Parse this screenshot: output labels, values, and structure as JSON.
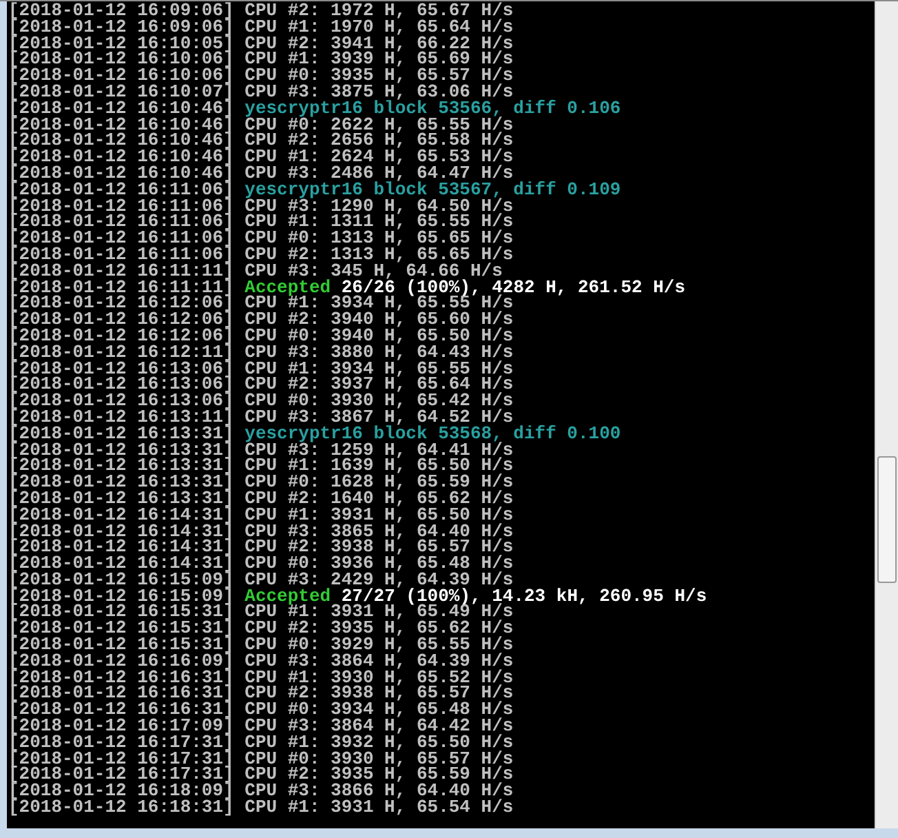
{
  "console": {
    "lines": [
      {
        "kind": "cpu",
        "time": "[2018-01-12 16:09:06]",
        "text": "CPU #2: 1972 H, 65.67 H/s"
      },
      {
        "kind": "cpu",
        "time": "[2018-01-12 16:09:06]",
        "text": "CPU #1: 1970 H, 65.64 H/s"
      },
      {
        "kind": "cpu",
        "time": "[2018-01-12 16:10:05]",
        "text": "CPU #2: 3941 H, 66.22 H/s"
      },
      {
        "kind": "cpu",
        "time": "[2018-01-12 16:10:06]",
        "text": "CPU #1: 3939 H, 65.69 H/s"
      },
      {
        "kind": "cpu",
        "time": "[2018-01-12 16:10:06]",
        "text": "CPU #0: 3935 H, 65.57 H/s"
      },
      {
        "kind": "cpu",
        "time": "[2018-01-12 16:10:07]",
        "text": "CPU #3: 3875 H, 63.06 H/s"
      },
      {
        "kind": "block",
        "time": "[2018-01-12 16:10:46]",
        "text": "yescryptr16 block 53566, diff 0.106"
      },
      {
        "kind": "cpu",
        "time": "[2018-01-12 16:10:46]",
        "text": "CPU #0: 2622 H, 65.55 H/s"
      },
      {
        "kind": "cpu",
        "time": "[2018-01-12 16:10:46]",
        "text": "CPU #2: 2656 H, 65.58 H/s"
      },
      {
        "kind": "cpu",
        "time": "[2018-01-12 16:10:46]",
        "text": "CPU #1: 2624 H, 65.53 H/s"
      },
      {
        "kind": "cpu",
        "time": "[2018-01-12 16:10:46]",
        "text": "CPU #3: 2486 H, 64.47 H/s"
      },
      {
        "kind": "block",
        "time": "[2018-01-12 16:11:06]",
        "text": "yescryptr16 block 53567, diff 0.109"
      },
      {
        "kind": "cpu",
        "time": "[2018-01-12 16:11:06]",
        "text": "CPU #3: 1290 H, 64.50 H/s"
      },
      {
        "kind": "cpu",
        "time": "[2018-01-12 16:11:06]",
        "text": "CPU #1: 1311 H, 65.55 H/s"
      },
      {
        "kind": "cpu",
        "time": "[2018-01-12 16:11:06]",
        "text": "CPU #0: 1313 H, 65.65 H/s"
      },
      {
        "kind": "cpu",
        "time": "[2018-01-12 16:11:06]",
        "text": "CPU #2: 1313 H, 65.65 H/s"
      },
      {
        "kind": "cpu",
        "time": "[2018-01-12 16:11:11]",
        "text": "CPU #3: 345 H, 64.66 H/s"
      },
      {
        "kind": "accepted",
        "time": "[2018-01-12 16:11:11]",
        "status": "Accepted",
        "text": "26/26 (100%), 4282 H, 261.52 H/s"
      },
      {
        "kind": "cpu",
        "time": "[2018-01-12 16:12:06]",
        "text": "CPU #1: 3934 H, 65.55 H/s"
      },
      {
        "kind": "cpu",
        "time": "[2018-01-12 16:12:06]",
        "text": "CPU #2: 3940 H, 65.60 H/s"
      },
      {
        "kind": "cpu",
        "time": "[2018-01-12 16:12:06]",
        "text": "CPU #0: 3940 H, 65.50 H/s"
      },
      {
        "kind": "cpu",
        "time": "[2018-01-12 16:12:11]",
        "text": "CPU #3: 3880 H, 64.43 H/s"
      },
      {
        "kind": "cpu",
        "time": "[2018-01-12 16:13:06]",
        "text": "CPU #1: 3934 H, 65.55 H/s"
      },
      {
        "kind": "cpu",
        "time": "[2018-01-12 16:13:06]",
        "text": "CPU #2: 3937 H, 65.64 H/s"
      },
      {
        "kind": "cpu",
        "time": "[2018-01-12 16:13:06]",
        "text": "CPU #0: 3930 H, 65.42 H/s"
      },
      {
        "kind": "cpu",
        "time": "[2018-01-12 16:13:11]",
        "text": "CPU #3: 3867 H, 64.52 H/s"
      },
      {
        "kind": "block",
        "time": "[2018-01-12 16:13:31]",
        "text": "yescryptr16 block 53568, diff 0.100"
      },
      {
        "kind": "cpu",
        "time": "[2018-01-12 16:13:31]",
        "text": "CPU #3: 1259 H, 64.41 H/s"
      },
      {
        "kind": "cpu",
        "time": "[2018-01-12 16:13:31]",
        "text": "CPU #1: 1639 H, 65.50 H/s"
      },
      {
        "kind": "cpu",
        "time": "[2018-01-12 16:13:31]",
        "text": "CPU #0: 1628 H, 65.59 H/s"
      },
      {
        "kind": "cpu",
        "time": "[2018-01-12 16:13:31]",
        "text": "CPU #2: 1640 H, 65.62 H/s"
      },
      {
        "kind": "cpu",
        "time": "[2018-01-12 16:14:31]",
        "text": "CPU #1: 3931 H, 65.50 H/s"
      },
      {
        "kind": "cpu",
        "time": "[2018-01-12 16:14:31]",
        "text": "CPU #3: 3865 H, 64.40 H/s"
      },
      {
        "kind": "cpu",
        "time": "[2018-01-12 16:14:31]",
        "text": "CPU #2: 3938 H, 65.57 H/s"
      },
      {
        "kind": "cpu",
        "time": "[2018-01-12 16:14:31]",
        "text": "CPU #0: 3936 H, 65.48 H/s"
      },
      {
        "kind": "cpu",
        "time": "[2018-01-12 16:15:09]",
        "text": "CPU #3: 2429 H, 64.39 H/s"
      },
      {
        "kind": "accepted",
        "time": "[2018-01-12 16:15:09]",
        "status": "Accepted",
        "text": "27/27 (100%), 14.23 kH, 260.95 H/s"
      },
      {
        "kind": "cpu",
        "time": "[2018-01-12 16:15:31]",
        "text": "CPU #1: 3931 H, 65.49 H/s"
      },
      {
        "kind": "cpu",
        "time": "[2018-01-12 16:15:31]",
        "text": "CPU #2: 3935 H, 65.62 H/s"
      },
      {
        "kind": "cpu",
        "time": "[2018-01-12 16:15:31]",
        "text": "CPU #0: 3929 H, 65.55 H/s"
      },
      {
        "kind": "cpu",
        "time": "[2018-01-12 16:16:09]",
        "text": "CPU #3: 3864 H, 64.39 H/s"
      },
      {
        "kind": "cpu",
        "time": "[2018-01-12 16:16:31]",
        "text": "CPU #1: 3930 H, 65.52 H/s"
      },
      {
        "kind": "cpu",
        "time": "[2018-01-12 16:16:31]",
        "text": "CPU #2: 3938 H, 65.57 H/s"
      },
      {
        "kind": "cpu",
        "time": "[2018-01-12 16:16:31]",
        "text": "CPU #0: 3934 H, 65.48 H/s"
      },
      {
        "kind": "cpu",
        "time": "[2018-01-12 16:17:09]",
        "text": "CPU #3: 3864 H, 64.42 H/s"
      },
      {
        "kind": "cpu",
        "time": "[2018-01-12 16:17:31]",
        "text": "CPU #1: 3932 H, 65.50 H/s"
      },
      {
        "kind": "cpu",
        "time": "[2018-01-12 16:17:31]",
        "text": "CPU #0: 3930 H, 65.57 H/s"
      },
      {
        "kind": "cpu",
        "time": "[2018-01-12 16:17:31]",
        "text": "CPU #2: 3935 H, 65.59 H/s"
      },
      {
        "kind": "cpu",
        "time": "[2018-01-12 16:18:09]",
        "text": "CPU #3: 3866 H, 64.40 H/s"
      },
      {
        "kind": "cpu",
        "time": "[2018-01-12 16:18:31]",
        "text": "CPU #1: 3931 H, 65.54 H/s"
      }
    ]
  }
}
